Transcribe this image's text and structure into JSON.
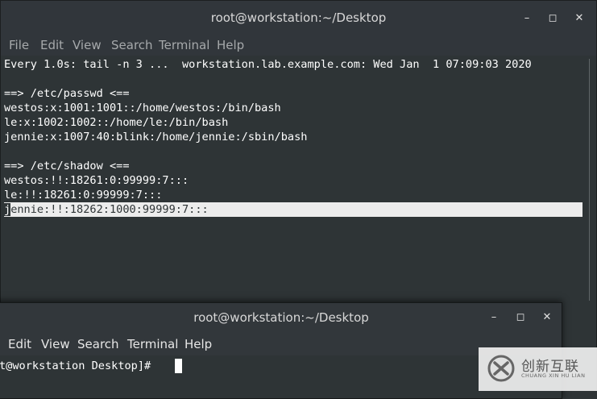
{
  "window_back": {
    "title": "root@workstation:~/Desktop",
    "controls": {
      "minimize": "–",
      "maximize": "◻",
      "close": "✕"
    },
    "menu": [
      "File",
      "Edit",
      "View",
      "Search",
      "Terminal",
      "Help"
    ],
    "terminal_lines": [
      "Every 1.0s: tail -n 3 ...  workstation.lab.example.com: Wed Jan  1 07:09:03 2020",
      "",
      "==> /etc/passwd <==",
      "westos:x:1001:1001::/home/westos:/bin/bash",
      "le:x:1002:1002::/home/le:/bin/bash",
      "jennie:x:1007:40:blink:/home/jennie:/sbin/bash",
      "",
      "==> /etc/shadow <==",
      "westos:!!:18261:0:99999:7:::",
      "le:!!:18261:0:99999:7:::"
    ],
    "highlighted_line": {
      "first_char": "j",
      "rest": "ennie:!!:18262:1000:99999:7:::"
    }
  },
  "window_front": {
    "title": "root@workstation:~/Desktop",
    "controls": {
      "minimize": "–",
      "maximize": "◻",
      "close": "✕"
    },
    "menu": [
      "Edit",
      "View",
      "Search",
      "Terminal",
      "Help"
    ],
    "prompt": "t@workstation Desktop]# "
  },
  "watermark": {
    "name_cn": "创新互联",
    "name_en": "CHUANG XIN HU LIAN"
  },
  "colors": {
    "terminal_bg": "#2e3436",
    "titlebar_bg": "#31363b",
    "highlight_bg": "#ececec"
  }
}
